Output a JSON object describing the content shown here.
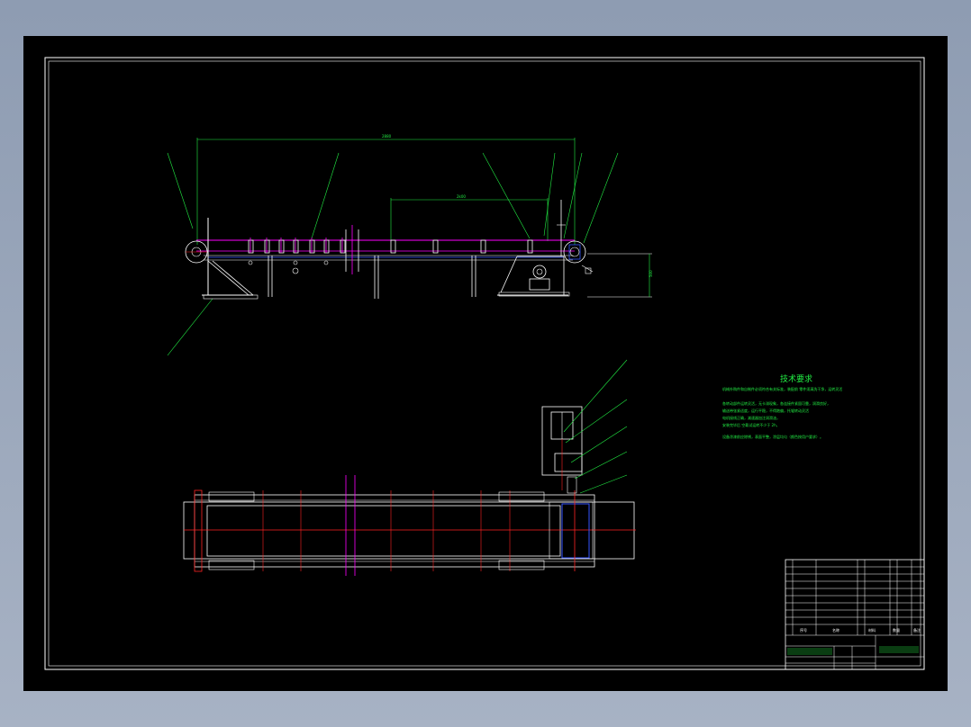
{
  "drawing": {
    "background": "#000000",
    "colors": {
      "frame": "#ffffff",
      "dimension": "#22ee44",
      "belt_line": "#ff00ff",
      "center_line": "#ff2222",
      "return_line": "#3355ff",
      "structure": "#ffffff"
    }
  },
  "dimensions": {
    "overall_length": "2880",
    "span_length": "2k00",
    "side_height": "500"
  },
  "technical_notes": {
    "title": "技术要求",
    "lines": [
      "机械外购件和自制件必须符合有关标准，装配前 零件须清洗干净，运转灵活",
      "",
      "各转动部件运转灵活，无卡滞现象，各连接件紧固可靠，润滑良好，",
      "输送带张紧适度，运行平稳，不得跑偏，托辊转动灵活",
      "电机接线正确，减速器加注润滑油，",
      "安装完毕后 空载试运转不少于 2h，",
      "设备涂漆前应除锈，表面平整，涂层均匀（颜色按用户要求）。"
    ]
  },
  "title_block": {
    "rows_left": [
      "",
      "",
      "",
      "",
      "",
      "",
      "",
      "",
      "",
      "",
      "",
      ""
    ],
    "headers": [
      "序号",
      "名称",
      "材料",
      "数量",
      "备注"
    ],
    "drawing_name": "带式输送机总装图"
  }
}
